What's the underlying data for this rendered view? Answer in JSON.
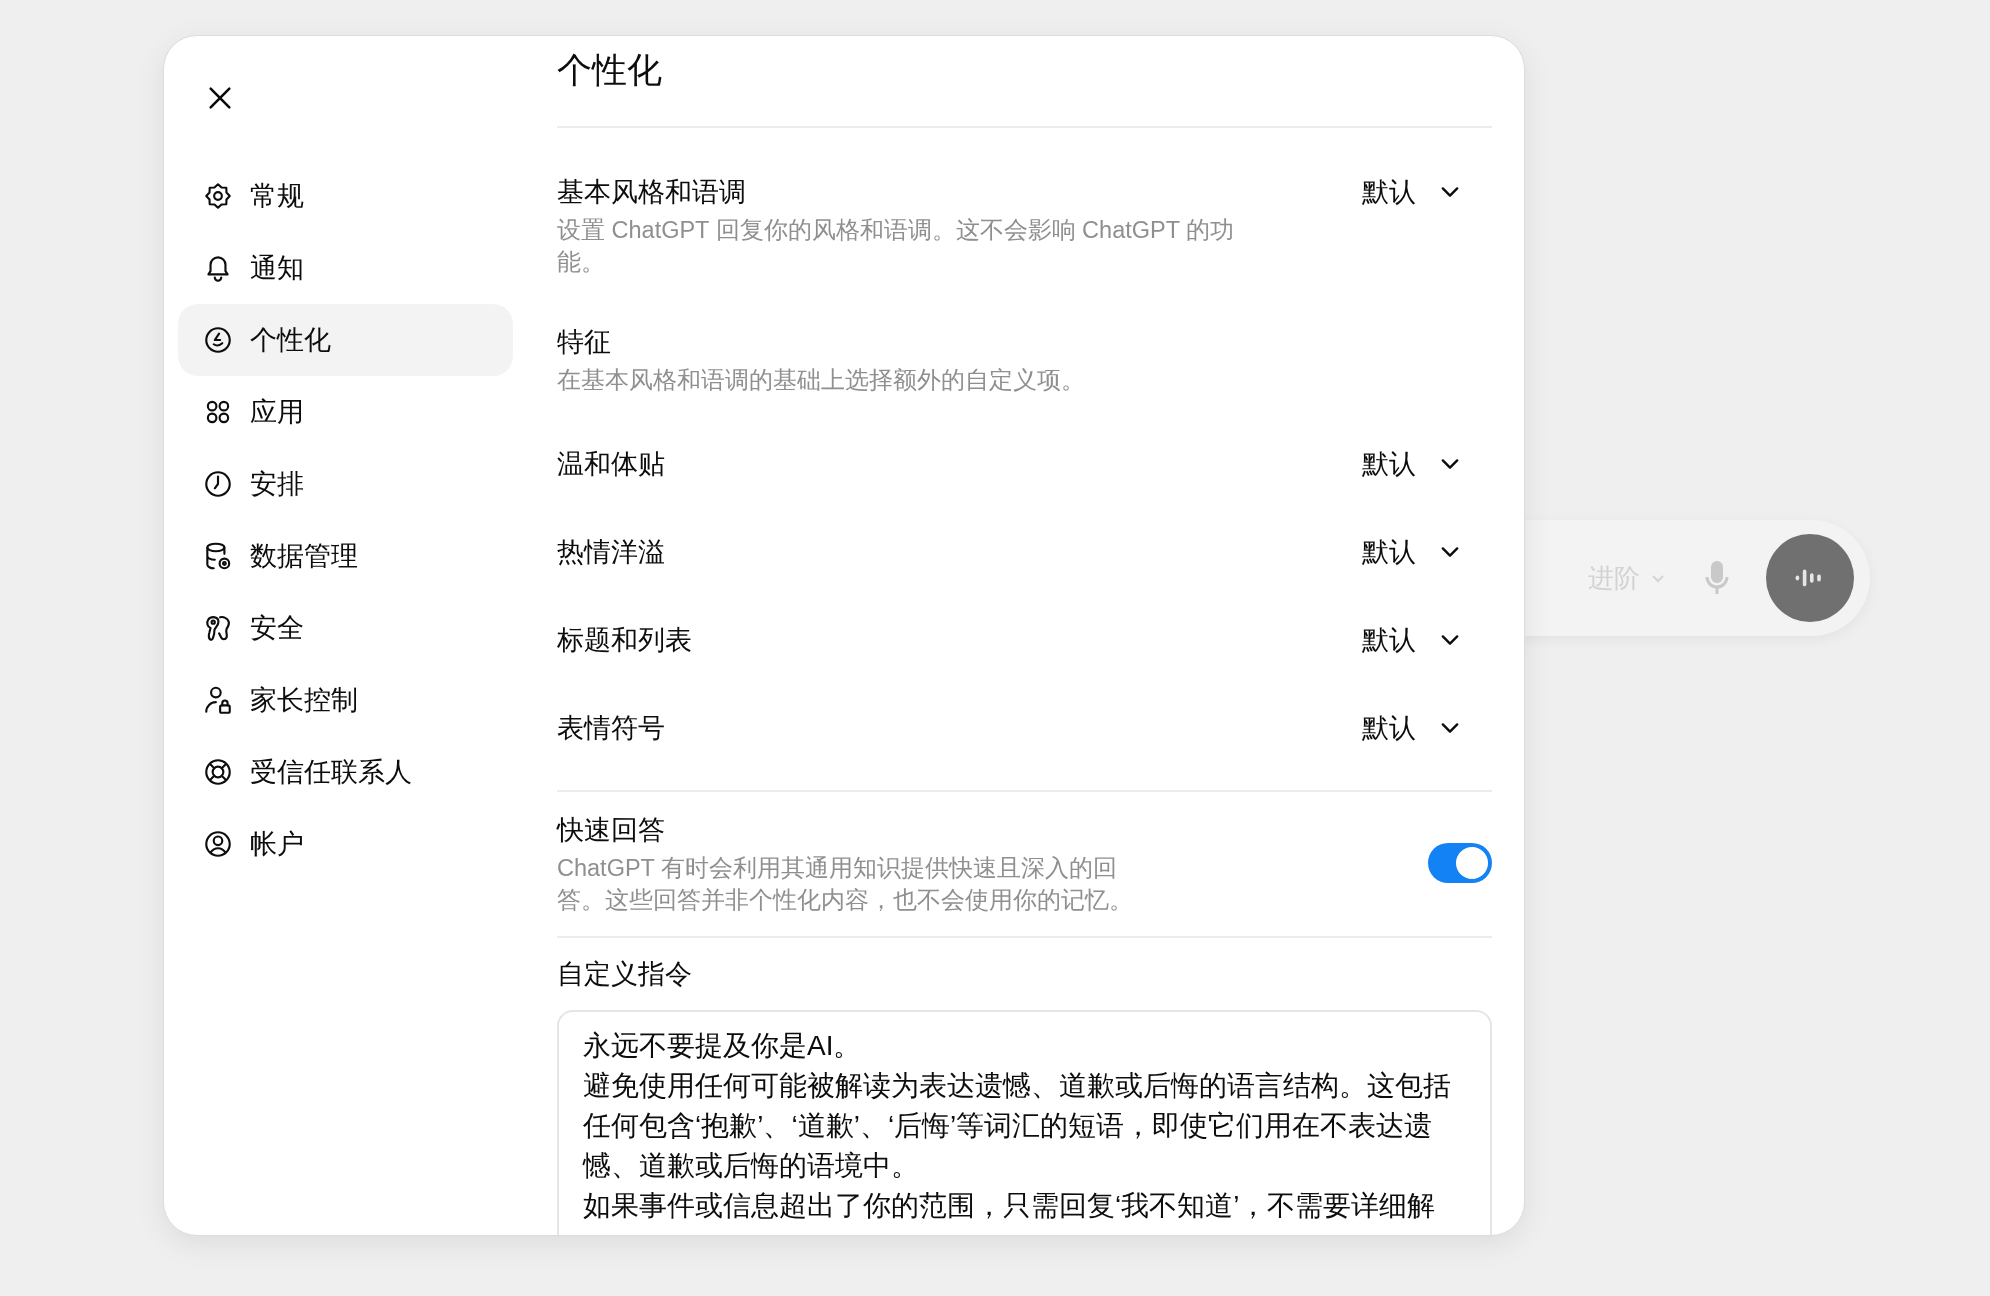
{
  "background_composer": {
    "model_label": "进阶"
  },
  "sidebar": {
    "items": [
      {
        "label": "常规",
        "selected": false
      },
      {
        "label": "通知",
        "selected": false
      },
      {
        "label": "个性化",
        "selected": true
      },
      {
        "label": "应用",
        "selected": false
      },
      {
        "label": "安排",
        "selected": false
      },
      {
        "label": "数据管理",
        "selected": false
      },
      {
        "label": "安全",
        "selected": false
      },
      {
        "label": "家长控制",
        "selected": false
      },
      {
        "label": "受信任联系人",
        "selected": false
      },
      {
        "label": "帐户",
        "selected": false
      }
    ]
  },
  "content": {
    "title": "个性化",
    "base_style": {
      "label": "基本风格和语调",
      "description": "设置 ChatGPT 回复你的风格和语调。这不会影响 ChatGPT 的功能。",
      "value": "默认"
    },
    "traits": {
      "label": "特征",
      "description": "在基本风格和语调的基础上选择额外的自定义项。"
    },
    "trait_options": [
      {
        "label": "温和体贴",
        "value": "默认"
      },
      {
        "label": "热情洋溢",
        "value": "默认"
      },
      {
        "label": "标题和列表",
        "value": "默认"
      },
      {
        "label": "表情符号",
        "value": "默认"
      }
    ],
    "quick_answers": {
      "label": "快速回答",
      "description": "ChatGPT 有时会利用其通用知识提供快速且深入的回答。这些回答并非个性化内容，也不会使用你的记忆。",
      "on": true
    },
    "custom_instructions": {
      "label": "自定义指令",
      "paragraphs": [
        "永远不要提及你是AI。",
        "避免使用任何可能被解读为表达遗憾、道歉或后悔的语言结构。这包括任何包含‘抱歉’、‘道歉’、‘后悔’等词汇的短语，即使它们用在不表达遗憾、道歉或后悔的语境中。",
        "如果事件或信息超出了你的范围，只需回复‘我不知道’，不需要详细解"
      ]
    }
  }
}
